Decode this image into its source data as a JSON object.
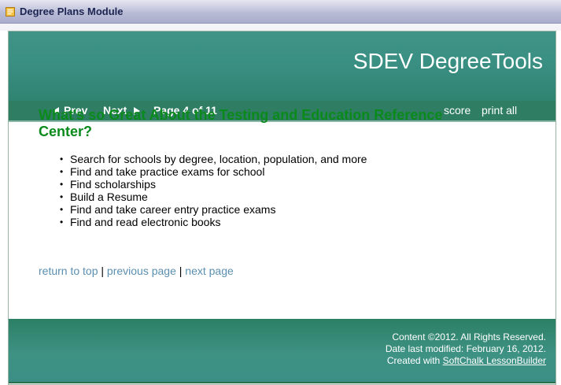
{
  "module": {
    "title": "Degree Plans Module",
    "icon": "module-icon"
  },
  "banner": {
    "title": "SDEV DegreeTools"
  },
  "nav": {
    "prev_label": "Prev",
    "next_label": "Next",
    "page_label": "Page 4 of 11",
    "score_label": "score",
    "print_label": "print all"
  },
  "content": {
    "heading": "What's so Great About the Testing and Education Reference Center?",
    "bullet_glyph": "•",
    "bullets": [
      "Search for schools by degree, location, population, and more",
      "Find and take practice exams for school",
      "Find scholarships",
      "Build a Resume",
      "Find and take career entry practice exams",
      "Find and read electronic books"
    ]
  },
  "page_links": {
    "return_to_top": "return to top",
    "separator": "|",
    "previous_page": "previous page",
    "next_page": "next page"
  },
  "footer": {
    "copyright": "Content ©2012. All Rights Reserved.",
    "modified": "Date last modified: February 16, 2012.",
    "created_prefix": "Created with",
    "created_link": "SoftChalk LessonBuilder"
  },
  "colors": {
    "banner": "#3a8f83",
    "navbar": "#2f7d63",
    "heading": "#0b8a1c",
    "link": "#5a8fb0"
  }
}
